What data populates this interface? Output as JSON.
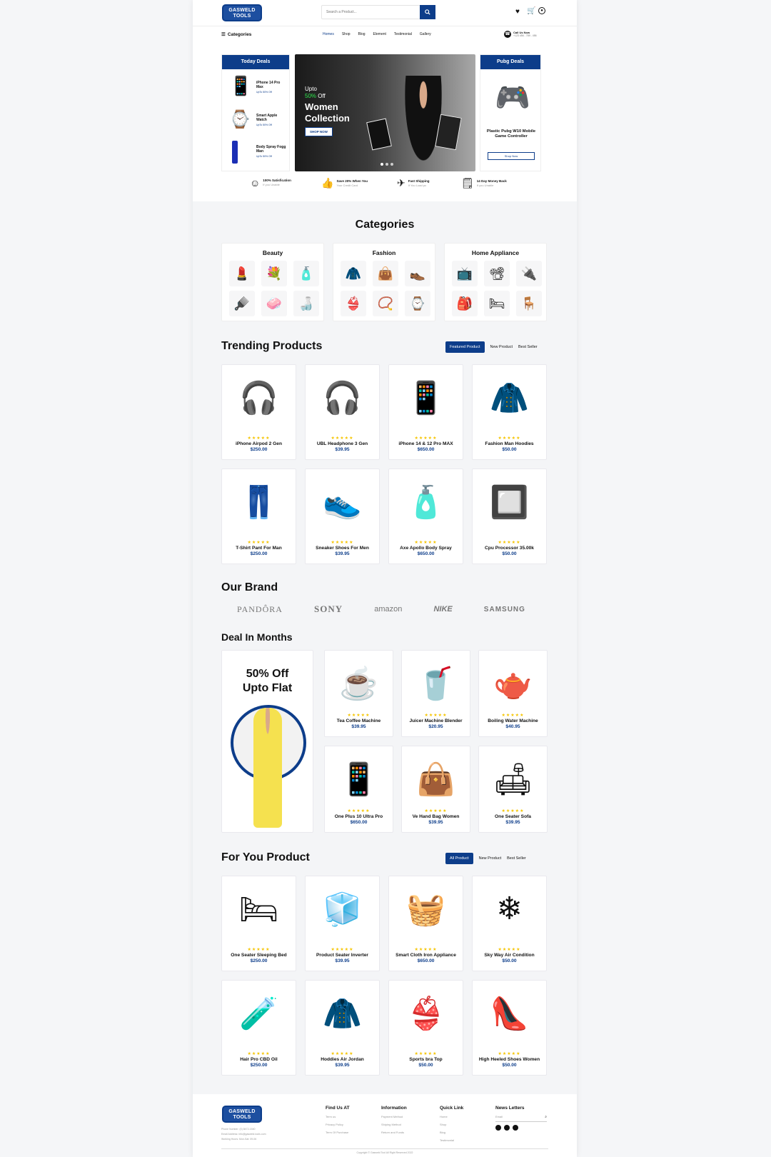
{
  "brand": {
    "line1": "GASWELD",
    "line2": "TOOLS"
  },
  "search": {
    "placeholder": "Search a Product..."
  },
  "nav": {
    "categories_label": "Categories",
    "links": [
      "Homes",
      "Shop",
      "Blog",
      "Element",
      "Testimonial",
      "Gallery"
    ],
    "call_title": "Call Us Now",
    "call_number": "+123 456 - 789 - 456"
  },
  "today_deals": {
    "title": "Today Deals",
    "items": [
      {
        "name": "iPhone 14 Pro Max",
        "offer": "UpTo 50% Off"
      },
      {
        "name": "Smart Apple Watch",
        "offer": "UpTo 50% Off"
      },
      {
        "name": "Body Spray Fogg Man",
        "offer": "UpTo 50% Off"
      }
    ]
  },
  "hero": {
    "upto": "Upto",
    "discount": "50%",
    "off": " Off",
    "title1": "Women",
    "title2": "Collection",
    "button": "SHOP NOW"
  },
  "pubg_deals": {
    "title": "Pubg Deals",
    "product": "Plastic Pubg W10 Mobile Game Controller",
    "button": "Shop Now"
  },
  "features": [
    {
      "title": "100% Satisfication",
      "sub": "If you Unable"
    },
    {
      "title": "Save 20% When You",
      "sub": "Your Credit Card"
    },
    {
      "title": "Fast Shipping",
      "sub": "If You Load pc"
    },
    {
      "title": "14 Day Money Back",
      "sub": "If you Unable"
    }
  ],
  "categories": {
    "title": "Categories",
    "groups": [
      {
        "name": "Beauty",
        "icons": [
          "💄",
          "💐",
          "🧴",
          "🪮",
          "🧼",
          "🍶"
        ]
      },
      {
        "name": "Fashion",
        "icons": [
          "🧥",
          "👜",
          "👞",
          "👙",
          "📿",
          "⌚"
        ]
      },
      {
        "name": "Home Appliance",
        "icons": [
          "📺",
          "📽",
          "🔌",
          "🎒",
          "🛏",
          "🪑"
        ]
      }
    ]
  },
  "trending": {
    "title": "Trending Products",
    "tabs": [
      "Featured Product",
      "New Product",
      "Best Seller"
    ],
    "products": [
      {
        "name": "iPhone Airpod 2 Gen",
        "price": "$250.00",
        "icon": "🎧"
      },
      {
        "name": "UBL Headphone 3 Gen",
        "price": "$39.95",
        "icon": "🎧"
      },
      {
        "name": "iPhone 14 & 12 Pro MAX",
        "price": "$650.00",
        "icon": "📱"
      },
      {
        "name": "Fashion Man Hoodies",
        "price": "$50.00",
        "icon": "🧥"
      },
      {
        "name": "T-Shirt Pant For Man",
        "price": "$250.00",
        "icon": "👖"
      },
      {
        "name": "Sneaker Shoes For Men",
        "price": "$39.95",
        "icon": "👟"
      },
      {
        "name": "Axe Apollo Body Spray",
        "price": "$650.00",
        "icon": "🧴"
      },
      {
        "name": "Cpu Processor 35.00k",
        "price": "$50.00",
        "icon": "🔲"
      }
    ]
  },
  "brands": {
    "title": "Our Brand",
    "items": [
      "PANDÔRA",
      "SONY",
      "amazon",
      "NIKE",
      "SAMSUNG"
    ]
  },
  "deals_months": {
    "title": "Deal In Months",
    "promo1": "50% Off",
    "promo2": "Upto Flat",
    "products": [
      {
        "name": "Tea Coffee Machine",
        "price": "$39.95",
        "icon": "☕"
      },
      {
        "name": "Juicer Machine Blender",
        "price": "$20.95",
        "icon": "🥤"
      },
      {
        "name": "Boiling Water Machine",
        "price": "$40.95",
        "icon": "🫖"
      },
      {
        "name": "One Plus 10 Ultra Pro",
        "price": "$650.00",
        "icon": "📱"
      },
      {
        "name": "Ve Hand Bag Women",
        "price": "$39.95",
        "icon": "👜"
      },
      {
        "name": "One Seater Sofa",
        "price": "$39.95",
        "icon": "🛋"
      }
    ]
  },
  "for_you": {
    "title": "For You Product",
    "tabs": [
      "All Product",
      "New Product",
      "Best Seller"
    ],
    "products": [
      {
        "name": "One Seater Sleeping Bed",
        "price": "$250.00",
        "icon": "🛏"
      },
      {
        "name": "Product Seater Inverter",
        "price": "$39.95",
        "icon": "🧊"
      },
      {
        "name": "Smart Cloth Iron Appliance",
        "price": "$650.00",
        "icon": "🧺"
      },
      {
        "name": "Sky Way Air Condition",
        "price": "$50.00",
        "icon": "❄"
      },
      {
        "name": "Hair Pro CBD Oil",
        "price": "$250.00",
        "icon": "🧪"
      },
      {
        "name": "Hoddies Air Jordan",
        "price": "$39.95",
        "icon": "🧥"
      },
      {
        "name": "Sports bra Top",
        "price": "$50.00",
        "icon": "👙"
      },
      {
        "name": "High Heeled Shoes Women",
        "price": "$50.00",
        "icon": "👠"
      }
    ]
  },
  "footer": {
    "contact": [
      "Phone Number: (0) 8472-1540",
      "Email Address: info@gasweld-tools.com",
      "Working Hours: Mon-Sat: 09-06"
    ],
    "cols": [
      {
        "title": "Find Us AT",
        "links": [
          "Term us",
          "Privacy Policy",
          "Term Of Purchase"
        ]
      },
      {
        "title": "Information",
        "links": [
          "Payment Method",
          "Shiping Method",
          "Return and Funds"
        ]
      },
      {
        "title": "Quick Link",
        "links": [
          "Home",
          "Shop",
          "Blog",
          "Testimonial"
        ]
      }
    ],
    "newsletter_title": "News Letters",
    "email_placeholder": "Email",
    "copyright": "Copyright © Gasweld Tool All Right Reserved 2022"
  },
  "colors": {
    "primary": "#0d3d8a",
    "star": "#f5c400",
    "page_bg": "#f4f5f7"
  }
}
